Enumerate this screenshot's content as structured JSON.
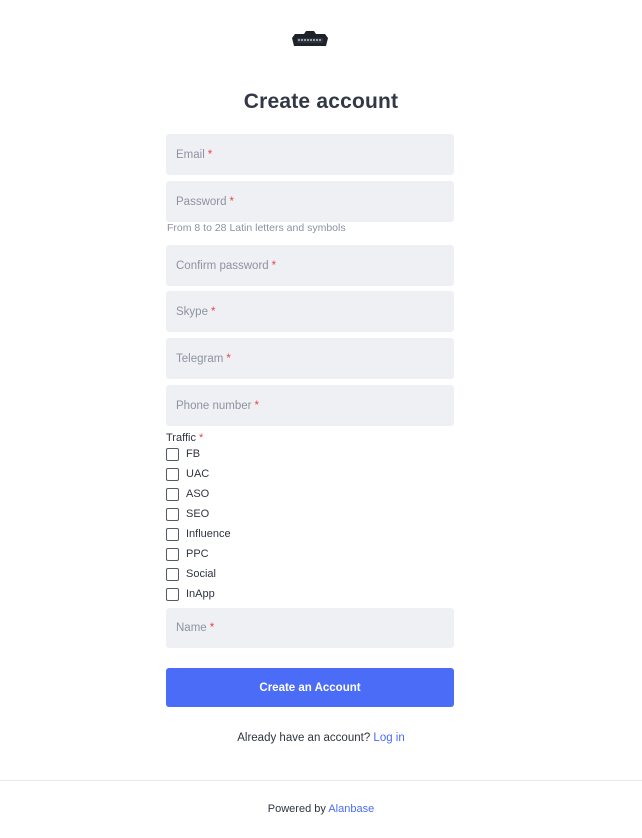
{
  "logo": {
    "text": "PARTNERS"
  },
  "form": {
    "title": "Create account",
    "required_mark": "*",
    "fields": {
      "email": "Email",
      "password": "Password",
      "confirm_password": "Confirm password",
      "skype": "Skype",
      "telegram": "Telegram",
      "phone": "Phone number",
      "name": "Name"
    },
    "password_hint": "From 8 to 28 Latin letters and symbols",
    "traffic": {
      "label": "Traffic",
      "options": [
        "FB",
        "UAC",
        "ASO",
        "SEO",
        "Influence",
        "PPC",
        "Social",
        "InApp"
      ],
      "checked": [
        false,
        false,
        false,
        false,
        false,
        false,
        false,
        false
      ]
    },
    "submit_label": "Create an Account"
  },
  "login": {
    "prompt": "Already have an account?",
    "link": "Log in"
  },
  "footer": {
    "powered_by": "Powered by",
    "brand": "Alanbase"
  },
  "colors": {
    "accent": "#4a6cf7",
    "required": "#e5474f",
    "field_bg": "#eff0f3"
  }
}
